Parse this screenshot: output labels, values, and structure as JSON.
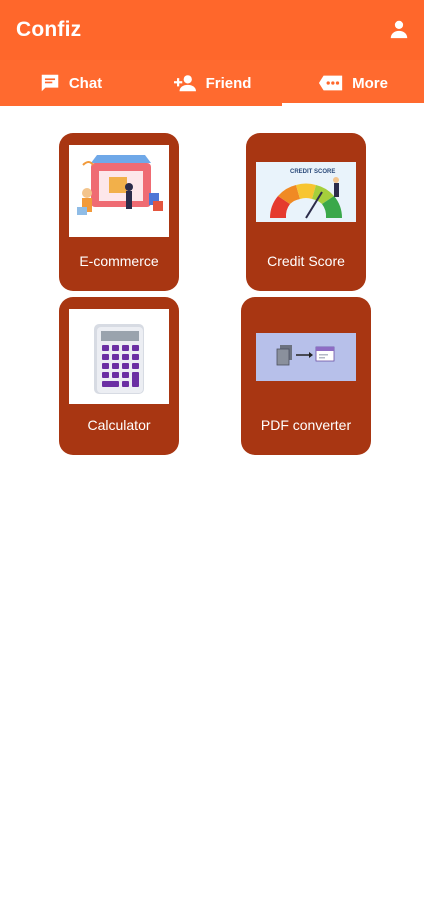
{
  "app": {
    "title": "Confiz"
  },
  "tabs": [
    {
      "label": "Chat",
      "icon": "chat-icon"
    },
    {
      "label": "Friend",
      "icon": "add-person-icon"
    },
    {
      "label": "More",
      "icon": "more-dots-icon"
    }
  ],
  "active_tab": "More",
  "cards": [
    {
      "label": "E-commerce",
      "icon": "ecommerce-illustration"
    },
    {
      "label": "Credit Score",
      "icon": "credit-score-gauge"
    },
    {
      "label": "Calculator",
      "icon": "calculator-illustration"
    },
    {
      "label": "PDF converter",
      "icon": "pdf-converter-illustration"
    }
  ],
  "credit_score_caption": "CREDIT SCORE",
  "colors": {
    "appbar": "#ff672b",
    "card": "#a83612",
    "text_on_primary": "#ffffff"
  }
}
